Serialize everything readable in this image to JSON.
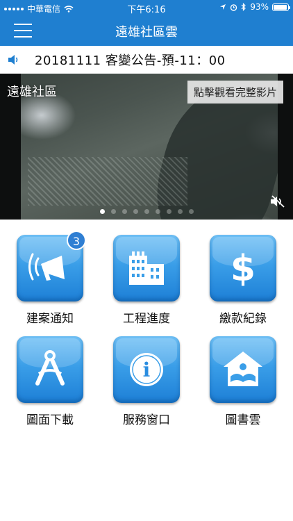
{
  "status_bar": {
    "carrier": "中華電信",
    "time": "下午6:16",
    "battery": "93%",
    "battery_level": 0.93,
    "icons": [
      "signal-icon",
      "wifi-icon",
      "location-icon",
      "alarm-icon",
      "bluetooth-icon",
      "battery-icon"
    ]
  },
  "navbar": {
    "title": "遠雄社區雲",
    "menu_icon": "hamburger-menu-icon"
  },
  "announcement": {
    "icon": "speaker-icon",
    "text": "20181111 客變公告-預-11：00"
  },
  "banner": {
    "label": "遠雄社區",
    "watch_button": "點擊觀看完整影片",
    "slide_count": 9,
    "active_slide": 1,
    "mute_icon": "mute-icon"
  },
  "tiles": [
    {
      "label": "建案通知",
      "icon": "megaphone-icon",
      "badge": "3"
    },
    {
      "label": "工程進度",
      "icon": "buildings-icon"
    },
    {
      "label": "繳款紀錄",
      "icon": "dollar-icon"
    },
    {
      "label": "圖面下載",
      "icon": "compass-icon"
    },
    {
      "label": "服務窗口",
      "icon": "info-icon"
    },
    {
      "label": "圖書雲",
      "icon": "book-house-icon"
    }
  ],
  "colors": {
    "brand_blue": "#1f7fd0",
    "tile_top": "#6fc0f5",
    "tile_bottom": "#1d7fd6",
    "badge": "#2f7fd3"
  }
}
